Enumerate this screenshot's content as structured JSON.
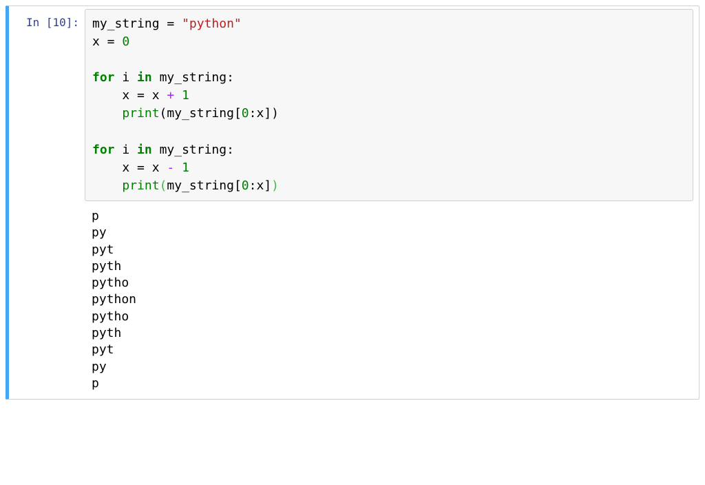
{
  "cell": {
    "prompt_label": "In [10]:",
    "code": {
      "line1": {
        "var1": "my_string",
        "assign": " = ",
        "str": "\"python\""
      },
      "line2": {
        "var1": "x",
        "assign": " = ",
        "num": "0"
      },
      "line3": "",
      "line4": {
        "kw1": "for",
        "sp1": " ",
        "var1": "i",
        "sp2": " ",
        "kw2": "in",
        "sp3": " ",
        "var2": "my_string",
        "colon": ":"
      },
      "line5": {
        "indent": "    ",
        "var1": "x",
        "assign": " = ",
        "var2": "x",
        "sp": " ",
        "op": "+",
        "sp2": " ",
        "num": "1"
      },
      "line6": {
        "indent": "    ",
        "builtin": "print",
        "lparen": "(",
        "var1": "my_string",
        "lbrack": "[",
        "num1": "0",
        "colon": ":",
        "var2": "x",
        "rbrack": "]",
        "rparen": ")"
      },
      "line7": "",
      "line8": {
        "kw1": "for",
        "sp1": " ",
        "var1": "i",
        "sp2": " ",
        "kw2": "in",
        "sp3": " ",
        "var2": "my_string",
        "colon": ":"
      },
      "line9": {
        "indent": "    ",
        "var1": "x",
        "assign": " = ",
        "var2": "x",
        "sp": " ",
        "op": "-",
        "sp2": " ",
        "num": "1"
      },
      "line10": {
        "indent": "    ",
        "builtin": "print",
        "lparen": "(",
        "var1": "my_string",
        "lbrack": "[",
        "num1": "0",
        "colon": ":",
        "var2": "x",
        "rbrack": "]",
        "rparen": ")"
      }
    },
    "output_lines": [
      "p",
      "py",
      "pyt",
      "pyth",
      "pytho",
      "python",
      "pytho",
      "pyth",
      "pyt",
      "py",
      "p"
    ]
  }
}
